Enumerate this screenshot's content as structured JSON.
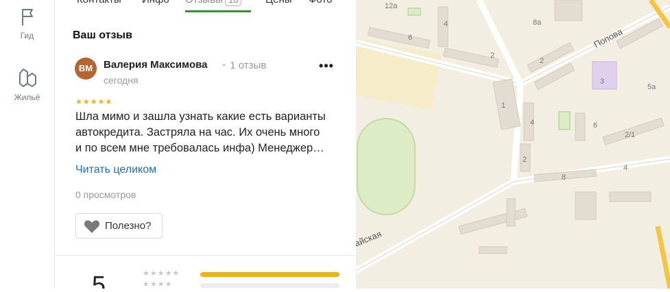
{
  "rail": {
    "guide_label": "Гид",
    "housing_label": "Жильё"
  },
  "tabs": [
    {
      "label": "Контакты"
    },
    {
      "label": "Инфо"
    },
    {
      "label": "Отзывы",
      "count": "16",
      "active": true
    },
    {
      "label": "Цены"
    },
    {
      "label": "Фото"
    }
  ],
  "section_title": "Ваш отзыв",
  "review": {
    "avatar_initials": "ВМ",
    "avatar_color": "#b6652e",
    "author": "Валерия Максимова",
    "reviews_count": "1 отзыв",
    "date": "сегодня",
    "stars": "★★★★★",
    "rating": 5,
    "text_lines": [
      "Шла мимо и зашла узнать какие есть варианты",
      "автокредита. Застряла на час. Их очень много",
      "и по всем мне требовалась инфа) Менеджер…"
    ],
    "read_more": "Читать целиком",
    "views": "0 просмотров",
    "useful_label": "Полезно?"
  },
  "rating_summary": {
    "value": "5",
    "rows": [
      {
        "stars": "★★★★★",
        "fraction": 1.0
      },
      {
        "stars": "★★★★",
        "fraction": 0.0
      }
    ]
  },
  "map": {
    "street_popova": "Попова",
    "street_partial": "айская",
    "house_numbers": [
      "12а",
      "4",
      "6",
      "2",
      "8а",
      "2",
      "3",
      "5а",
      "1",
      "4",
      "6",
      "2",
      "2/1",
      "8",
      "4"
    ],
    "colors": {
      "land": "#f2eee2",
      "road": "#ffffff",
      "building": "#e2ddd0",
      "green": "#dcecc4",
      "accent_road": "#f5c542"
    }
  },
  "colors": {
    "active_tab_underline": "#2b9a2b",
    "link": "#1a6cc4",
    "star": "#f5b301"
  }
}
